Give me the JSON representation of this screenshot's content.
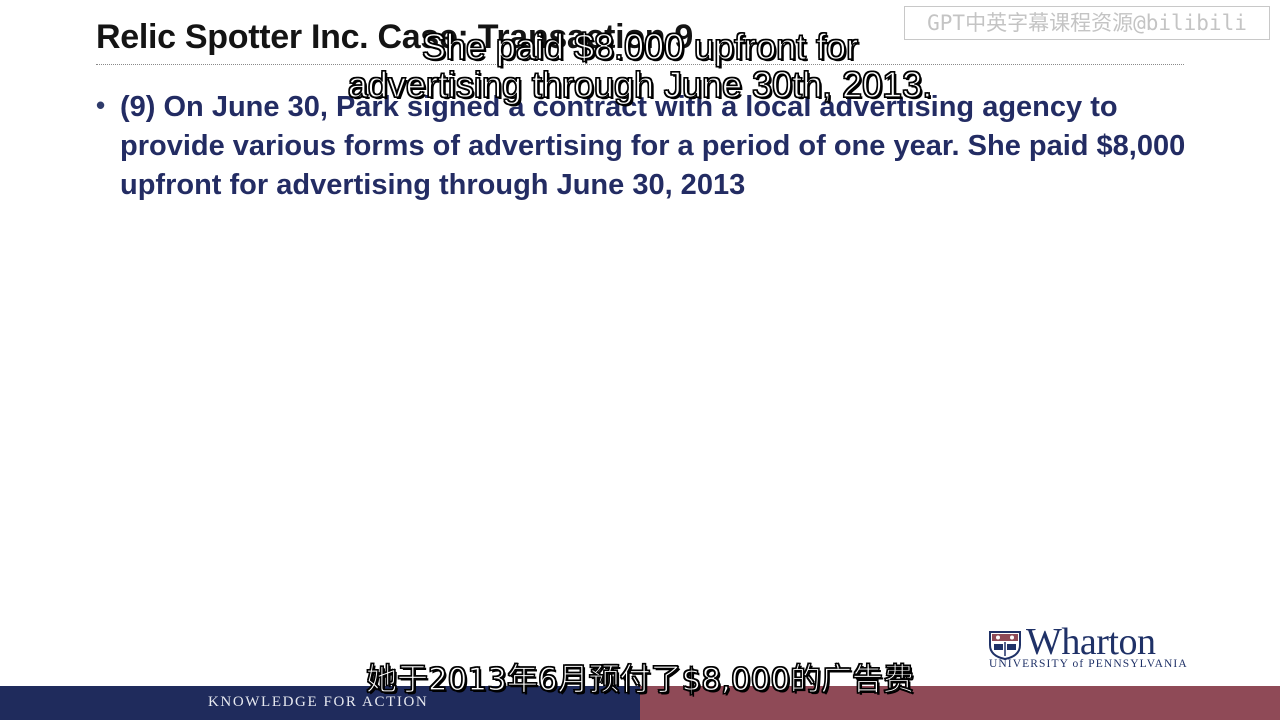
{
  "slide": {
    "title": "Relic Spotter Inc. Case: Transaction 9",
    "bullet_text": "(9) On June 30, Park signed a contract with a local advertising agency to provide various forms of advertising for a period of one year.  She paid $8,000 upfront for advertising through June 30, 2013"
  },
  "watermark": "GPT中英字幕课程资源@bilibili",
  "subtitles": {
    "english_line_1": "She paid $8.000 upfront for",
    "english_line_2": "advertising through June 30th, 2013.",
    "chinese": "她于2013年6月预付了$8,000的广告费"
  },
  "logo": {
    "wordmark": "Wharton",
    "subtitle": "UNIVERSITY of PENNSYLVANIA"
  },
  "footer": {
    "tagline": "KNOWLEDGE FOR ACTION"
  },
  "colors": {
    "title_text": "#141414",
    "bullet_text": "#232c63",
    "footer_left": "#1f2b5c",
    "footer_right": "#8f4a57",
    "logo": "#1f3167"
  }
}
